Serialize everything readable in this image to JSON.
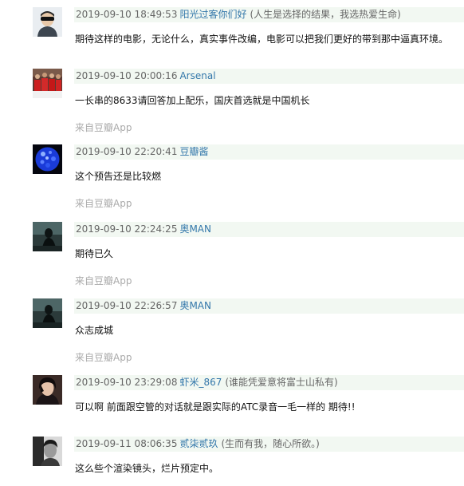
{
  "comments": [
    {
      "time": "2019-09-10 18:49:53",
      "user": "阳光过客你们好",
      "signature": "(人生是选择的结果，我选热爱生命)",
      "text": "期待这样的电影，无论什么，真实事件改编，电影可以把我们更好的带到那中逼真环境。",
      "source": "",
      "avatar_icon": "avatar-sunglasses-man-icon"
    },
    {
      "time": "2019-09-10 20:00:16",
      "user": "Arsenal",
      "signature": "",
      "text": "一长串的8633请回答加上配乐，国庆首选就是中国机长",
      "source": "来自豆瓣App",
      "avatar_icon": "avatar-arsenal-players-icon"
    },
    {
      "time": "2019-09-10 22:20:41",
      "user": "豆瓣酱",
      "signature": "",
      "text": "这个预告还是比较燃",
      "source": "来自豆瓣App",
      "avatar_icon": "avatar-blue-sphere-icon"
    },
    {
      "time": "2019-09-10 22:24:25",
      "user": "奥MAN",
      "signature": "",
      "text": "期待已久",
      "source": "来自豆瓣App",
      "avatar_icon": "avatar-dark-figure-icon"
    },
    {
      "time": "2019-09-10 22:26:57",
      "user": "奥MAN",
      "signature": "",
      "text": "众志成城",
      "source": "来自豆瓣App",
      "avatar_icon": "avatar-dark-figure-icon"
    },
    {
      "time": "2019-09-10 23:29:08",
      "user": "虾米_867",
      "signature": "(谁能凭爱意将富士山私有)",
      "text": "可以啊 前面跟空管的对话就是跟实际的ATC录音一毛一样的 期待!!",
      "source": "",
      "avatar_icon": "avatar-dark-hair-portrait-icon"
    },
    {
      "time": "2019-09-11 08:06:35",
      "user": "贰柒贰玖",
      "signature": "(生而有我，随心所欲。)",
      "text": "这么些个渲染镜头，烂片预定中。",
      "source": "",
      "avatar_icon": "avatar-bw-portrait-icon"
    }
  ]
}
